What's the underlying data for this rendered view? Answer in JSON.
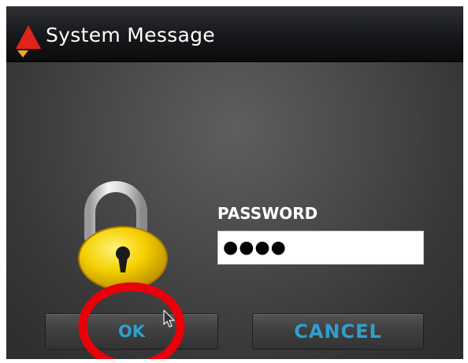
{
  "window": {
    "title": "System Message",
    "icon": "red-triangle-logo-icon"
  },
  "dialog": {
    "lock_icon": "padlock-icon",
    "password": {
      "label": "PASSWORD",
      "value": "●●●●"
    },
    "buttons": {
      "ok_label": "OK",
      "cancel_label": "CANCEL"
    }
  },
  "annotations": {
    "highlight": "red-circle-annotation",
    "cursor": "mouse-pointer-icon"
  },
  "colors": {
    "button_text": "#2f9fd0",
    "logo_red": "#e2231a",
    "logo_orange": "#f5a623",
    "highlight_red": "#e8000a",
    "lock_gold": "#f2c200"
  }
}
